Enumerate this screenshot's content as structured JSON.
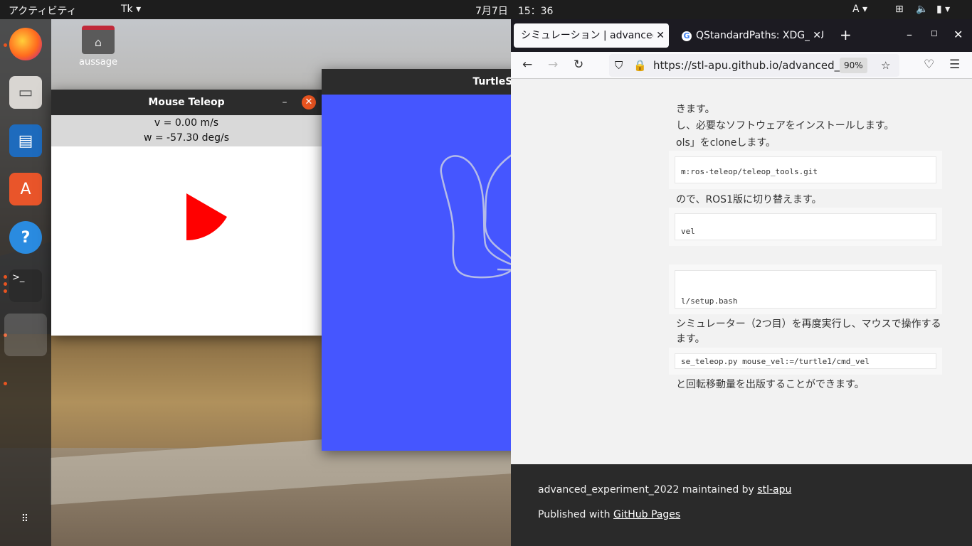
{
  "topbar": {
    "activities": "アクティビティ",
    "app_menu": "Tk",
    "clock": "7月7日　15：36",
    "input_method": "A"
  },
  "desktop": {
    "home_label": "aussage"
  },
  "dock": {
    "items": [
      "firefox-icon",
      "files-icon",
      "writer-icon",
      "software-icon",
      "help-icon",
      "terminal-icon",
      "app-icon"
    ]
  },
  "mouse_teleop": {
    "title": "Mouse Teleop",
    "v": "v = 0.00 m/s",
    "w": "w = -57.30 deg/s"
  },
  "turtlesim": {
    "title": "TurtleSim",
    "background": "#4556ff"
  },
  "firefox": {
    "tabs": [
      {
        "label": "シミュレーション | advanced"
      },
      {
        "label": "QStandardPaths: XDG_RU"
      }
    ],
    "url": "https://stl-apu.github.io/advanced_ex",
    "zoom": "90%",
    "lines": [
      "きます。",
      "し、必要なソフトウェアをインストールします。",
      "ols」をcloneします。",
      "ので、ROS1版に切り替えます。",
      "シミュレーター（2つ目）を再度実行し、マウスで操作する",
      "ます。",
      "と回転移動量を出版することができます。"
    ],
    "code": [
      "m:ros-teleop/teleop_tools.git",
      "vel",
      "l/setup.bash",
      "se_teleop.py mouse_vel:=/turtle1/cmd_vel"
    ],
    "footer": {
      "line1": "advanced_experiment_2022 maintained by ",
      "link1": "stl-apu",
      "line2": "Published with ",
      "link2": "GitHub Pages"
    }
  }
}
